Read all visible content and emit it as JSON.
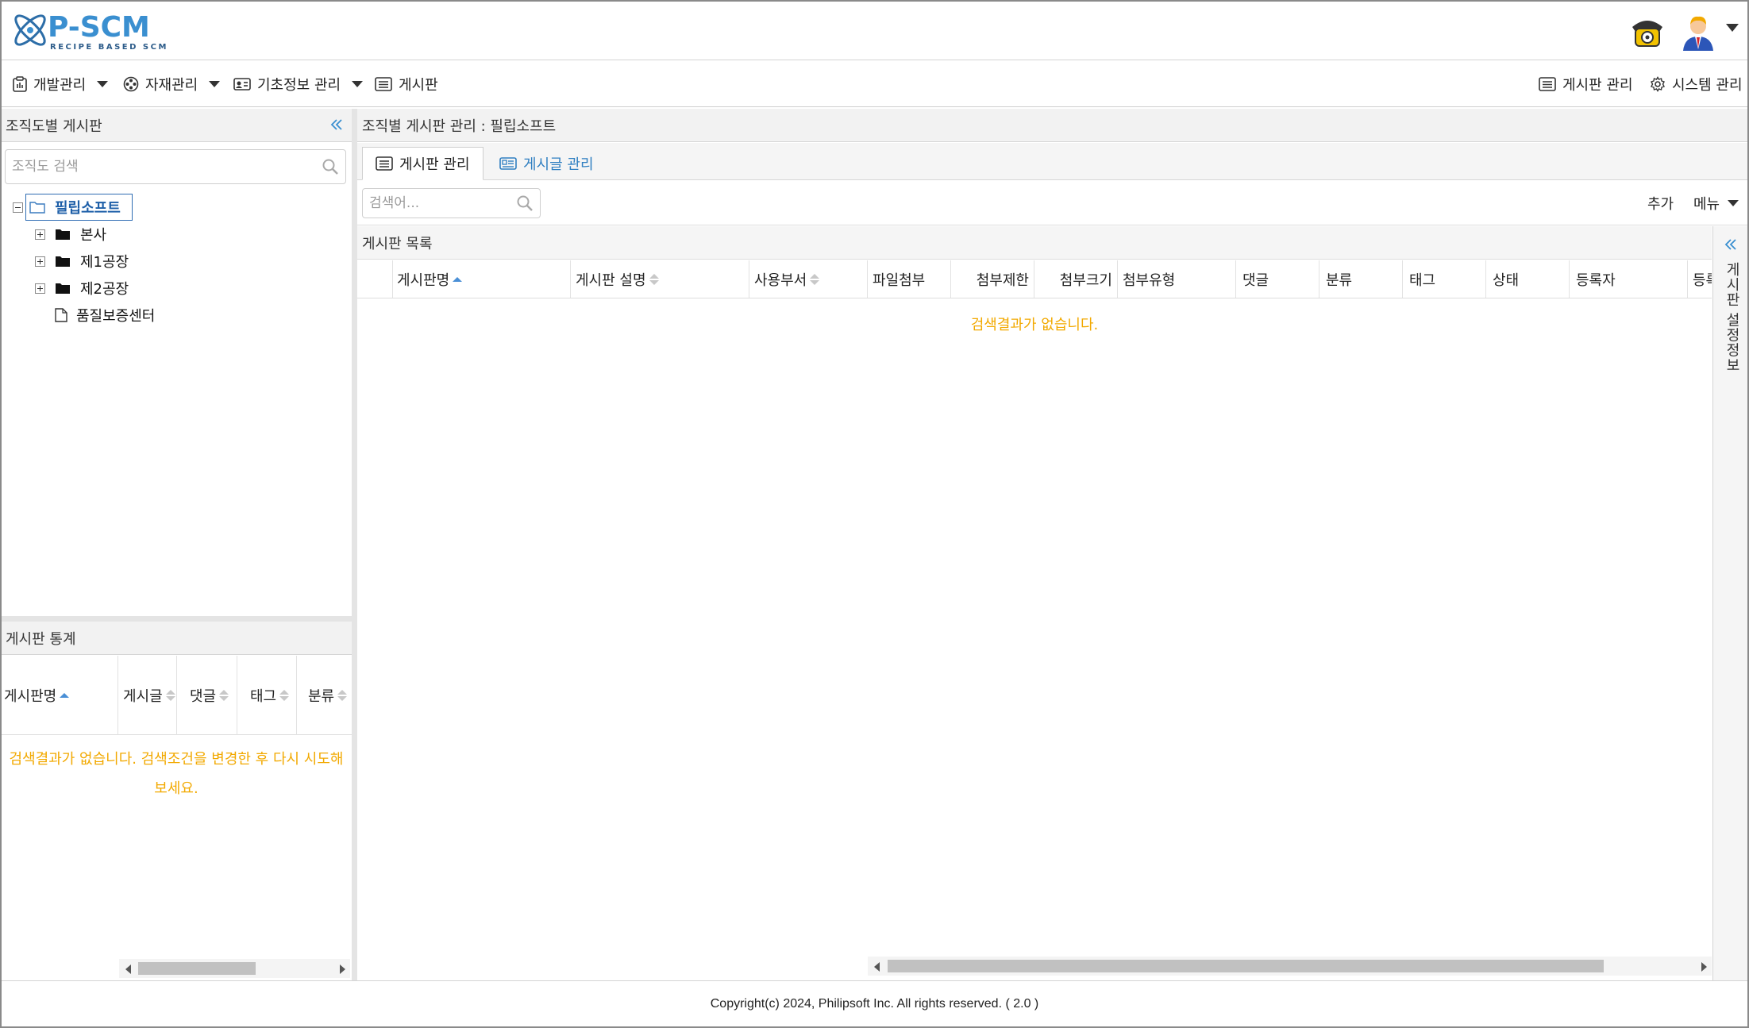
{
  "app": {
    "logo_text": "P-SCM",
    "logo_subtitle": "RECIPE BASED SCM"
  },
  "nav": {
    "items": [
      {
        "label": "개발관리",
        "icon": "clipboard-icon",
        "dropdown": true
      },
      {
        "label": "자재관리",
        "icon": "film-reel-icon",
        "dropdown": true
      },
      {
        "label": "기초정보 관리",
        "icon": "id-card-icon",
        "dropdown": true
      },
      {
        "label": "게시판",
        "icon": "list-icon",
        "dropdown": false
      }
    ],
    "right": [
      {
        "label": "게시판 관리",
        "icon": "list-icon"
      },
      {
        "label": "시스템 관리",
        "icon": "gear-icon"
      }
    ]
  },
  "left": {
    "title": "조직도별 게시판",
    "search_placeholder": "조직도 검색",
    "tree": {
      "root": "필립소프트",
      "children": [
        {
          "label": "본사",
          "type": "folder"
        },
        {
          "label": "제1공장",
          "type": "folder"
        },
        {
          "label": "제2공장",
          "type": "folder"
        },
        {
          "label": "품질보증센터",
          "type": "file"
        }
      ]
    },
    "stats": {
      "title": "게시판 통계",
      "columns": [
        "게시판명",
        "게시글",
        "댓글",
        "태그",
        "분류"
      ],
      "empty_message": "검색결과가 없습니다. 검색조건을 변경한 후 다시 시도해보세요."
    }
  },
  "main": {
    "title": "조직별 게시판 관리 : 필립소프트",
    "tabs": [
      {
        "label": "게시판 관리",
        "active": true
      },
      {
        "label": "게시글 관리",
        "active": false
      }
    ],
    "search_placeholder": "검색어...",
    "toolbar": {
      "add_label": "추가",
      "menu_label": "메뉴"
    },
    "list_title": "게시판 목록",
    "columns": [
      "게시판명",
      "게시판 설명",
      "사용부서",
      "파일첨부",
      "첨부제한",
      "첨부크기",
      "첨부유형",
      "댓글",
      "분류",
      "태그",
      "상태",
      "등록자",
      "등록"
    ],
    "empty_message": "검색결과가 없습니다."
  },
  "side_panel": {
    "label": "게시판 설정정보"
  },
  "footer": {
    "copyright": "Copyright(c) 2024, Philipsoft Inc. All rights reserved. ( 2.0 )"
  },
  "colors": {
    "accent": "#2f7fc1",
    "empty_text": "#f2a900",
    "logo": "#3a8fd0"
  }
}
